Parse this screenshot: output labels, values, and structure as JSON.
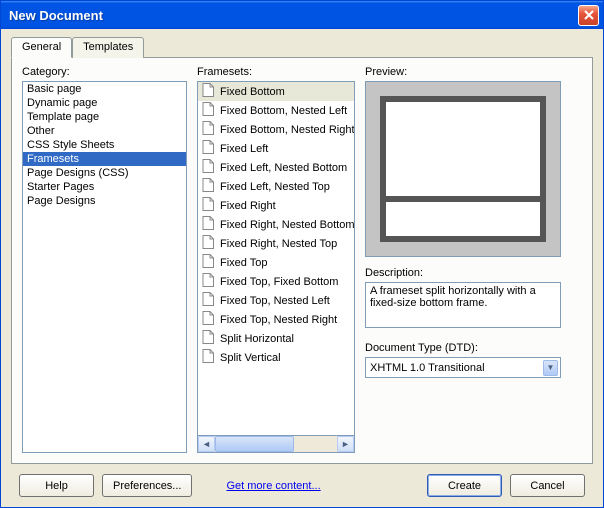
{
  "window": {
    "title": "New Document"
  },
  "tabs": [
    {
      "label": "General",
      "active": true
    },
    {
      "label": "Templates",
      "active": false
    }
  ],
  "labels": {
    "category": "Category:",
    "framesets": "Framesets:",
    "preview": "Preview:",
    "description": "Description:",
    "doctype": "Document Type (DTD):"
  },
  "categories": [
    "Basic page",
    "Dynamic page",
    "Template page",
    "Other",
    "CSS Style Sheets",
    "Framesets",
    "Page Designs (CSS)",
    "Starter Pages",
    "Page Designs"
  ],
  "category_selected": 5,
  "framesets": [
    "Fixed Bottom",
    "Fixed Bottom, Nested Left",
    "Fixed Bottom, Nested Right",
    "Fixed Left",
    "Fixed Left, Nested Bottom",
    "Fixed Left, Nested Top",
    "Fixed Right",
    "Fixed Right, Nested Bottom",
    "Fixed Right, Nested Top",
    "Fixed Top",
    "Fixed Top, Fixed Bottom",
    "Fixed Top, Nested Left",
    "Fixed Top, Nested Right",
    "Split Horizontal",
    "Split Vertical"
  ],
  "frameset_selected": 0,
  "description_text": "A frameset split horizontally with a fixed-size bottom frame.",
  "doctype_value": "XHTML 1.0 Transitional",
  "buttons": {
    "help": "Help",
    "preferences": "Preferences...",
    "getmore": "Get more content...",
    "create": "Create",
    "cancel": "Cancel"
  }
}
